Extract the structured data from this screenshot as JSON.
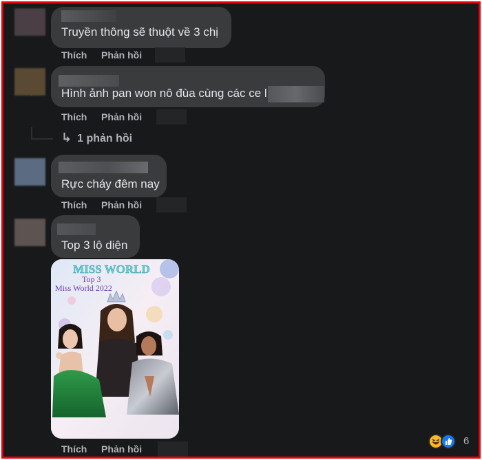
{
  "comments": [
    {
      "text": "Truyền thông sẽ thuột về 3 chị",
      "like_label": "Thích",
      "reply_label": "Phản hồi"
    },
    {
      "text": "Hình ảnh pan won nô đùa cùng các ce l",
      "like_label": "Thích",
      "reply_label": "Phản hồi",
      "replies_link": "1 phản hồi"
    },
    {
      "text": "Rực cháy đêm nay",
      "like_label": "Thích",
      "reply_label": "Phản hồi"
    },
    {
      "text": "Top 3 lộ diện",
      "like_label": "Thích",
      "reply_label": "Phản hồi",
      "reaction_count": "6",
      "reaction_icons": [
        "haha-icon",
        "like-icon"
      ]
    }
  ],
  "poster": {
    "brand": "MISS WORLD",
    "line1": "Top 3",
    "line2": "Miss World 2022"
  },
  "colors": {
    "background": "#18191a",
    "bubble": "#3a3b3c",
    "text": "#e4e6eb",
    "secondary_text": "#b0b3b8",
    "frame_border": "#e8000b",
    "like_blue": "#1877f2",
    "haha_yellow": "#f7b928"
  }
}
